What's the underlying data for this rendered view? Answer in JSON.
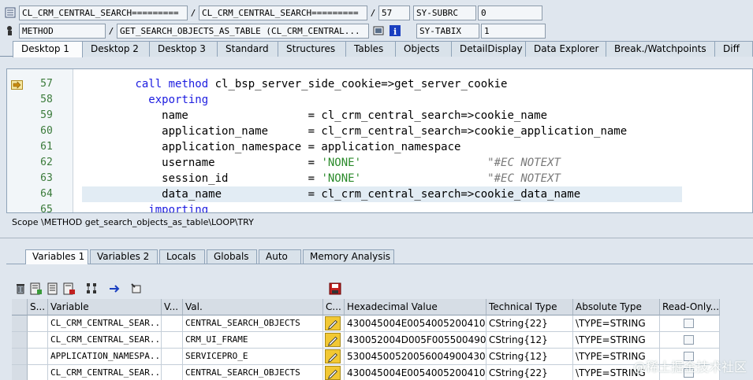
{
  "info": {
    "program": "CL_CRM_CENTRAL_SEARCH=========",
    "include": "CL_CRM_CENTRAL_SEARCH=========",
    "line": "57",
    "sy_subrc_label": "SY-SUBRC",
    "sy_subrc_value": "0",
    "event_type": "METHOD",
    "event": "GET_SEARCH_OBJECTS_AS_TABLE (CL_CRM_CENTRAL...",
    "sy_tabix_label": "SY-TABIX",
    "sy_tabix_value": "1",
    "slash": "/"
  },
  "desktop_tabs": [
    "Desktop 1",
    "Desktop 2",
    "Desktop 3",
    "Standard",
    "Structures",
    "Tables",
    "Objects",
    "DetailDisplay",
    "Data Explorer",
    "Break./Watchpoints",
    "Diff"
  ],
  "code_lines": [
    {
      "no": "57",
      "parts": [
        {
          "t": "        "
        },
        {
          "t": "call method",
          "k": "kw"
        },
        {
          "t": " cl_bsp_server_side_cookie=>get_server_cookie"
        }
      ]
    },
    {
      "no": "58",
      "parts": [
        {
          "t": "          "
        },
        {
          "t": "exporting",
          "k": "kw"
        }
      ]
    },
    {
      "no": "59",
      "parts": [
        {
          "t": "            name                  = cl_crm_central_search=>cookie_name"
        }
      ]
    },
    {
      "no": "60",
      "parts": [
        {
          "t": "            application_name      = cl_crm_central_search=>cookie_application_name"
        }
      ]
    },
    {
      "no": "61",
      "parts": [
        {
          "t": "            application_namespace = application_namespace"
        }
      ]
    },
    {
      "no": "62",
      "parts": [
        {
          "t": "            username              = "
        },
        {
          "t": "'NONE'",
          "k": "str"
        },
        {
          "t": "                   "
        },
        {
          "t": "\"#EC NOTEXT",
          "k": "cmt"
        }
      ]
    },
    {
      "no": "63",
      "parts": [
        {
          "t": "            session_id            = "
        },
        {
          "t": "'NONE'",
          "k": "str"
        },
        {
          "t": "                   "
        },
        {
          "t": "\"#EC NOTEXT",
          "k": "cmt"
        }
      ]
    },
    {
      "no": "64",
      "parts": [
        {
          "t": "            data_name             = cl_crm_central_search=>cookie_data_name"
        }
      ]
    },
    {
      "no": "65",
      "parts": [
        {
          "t": "          "
        },
        {
          "t": "importing",
          "k": "kw"
        }
      ]
    }
  ],
  "scope": "Scope \\METHOD get_search_objects_as_table\\LOOP\\TRY",
  "var_tabs": [
    "Variables 1",
    "Variables 2",
    "Locals",
    "Globals",
    "Auto",
    "Memory Analysis"
  ],
  "table": {
    "headers": [
      "S...",
      "Variable",
      "V...",
      "Val.",
      "C...",
      "Hexadecimal Value",
      "Technical Type",
      "Absolute Type",
      "Read-Only..."
    ],
    "rows": [
      {
        "variable": "CL_CRM_CENTRAL_SEAR...",
        "value": "CENTRAL_SEARCH_OBJECTS",
        "hex": "430045004E00540052004100...",
        "tech": "CString{22}",
        "abs": "\\TYPE=STRING"
      },
      {
        "variable": "CL_CRM_CENTRAL_SEAR...",
        "value": "CRM_UI_FRAME",
        "hex": "430052004D005F0055004900...",
        "tech": "CString{12}",
        "abs": "\\TYPE=STRING"
      },
      {
        "variable": "APPLICATION_NAMESPA...",
        "value": "SERVICEPRO_E",
        "hex": "530045005200560049004300...",
        "tech": "CString{12}",
        "abs": "\\TYPE=STRING"
      },
      {
        "variable": "CL_CRM_CENTRAL_SEAR...",
        "value": "CENTRAL_SEARCH_OBJECTS",
        "hex": "430045004E00540052004100...",
        "tech": "CString{22}",
        "abs": "\\TYPE=STRING"
      }
    ]
  },
  "watermark": "@稀土掘金技术社区"
}
